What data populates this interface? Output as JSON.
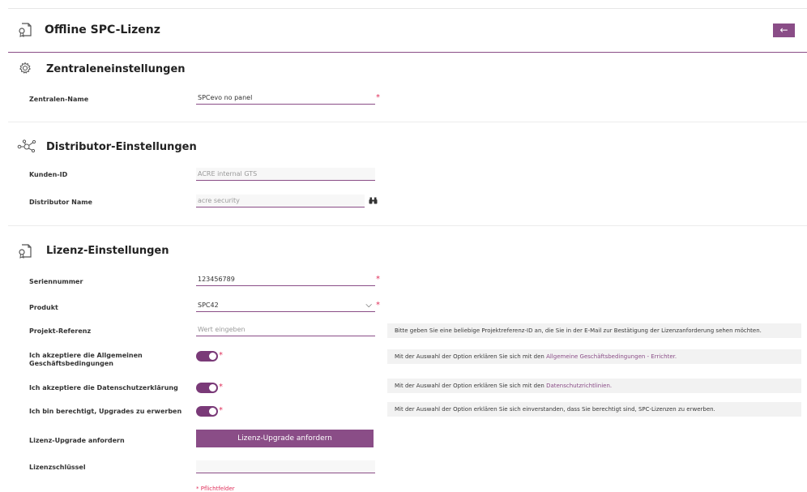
{
  "page": {
    "title": "Offline SPC-Lizenz",
    "back_icon": "←",
    "accent": "#8a4d87"
  },
  "zentrale": {
    "title": "Zentraleneinstellungen",
    "name_label": "Zentralen-Name",
    "name_value": "SPCevo no panel"
  },
  "distributor": {
    "title": "Distributor-Einstellungen",
    "kunden_label": "Kunden-ID",
    "kunden_value": "ACRE internal GTS",
    "name_label": "Distributor Name",
    "name_value": "acre security"
  },
  "lizenz": {
    "title": "Lizenz-Einstellungen",
    "serial_label": "Seriennummer",
    "serial_value": "123456789",
    "product_label": "Produkt",
    "product_value": "SPC42",
    "ref_label": "Projekt-Referenz",
    "ref_placeholder": "Wert eingeben",
    "ref_note": "Bitte geben Sie eine beliebige Projektreferenz-ID an, die Sie in der E-Mail zur Bestätigung der Lizenzanforderung sehen möchten.",
    "agb_label": "Ich akzeptiere die Allgemeinen Geschäftsbedingungen",
    "agb_note_prefix": "Mit der Auswahl der Option erklären Sie sich mit den ",
    "agb_note_link": "Allgemeine Geschäftsbedingungen - Errichter.",
    "ds_label": "Ich akzeptiere die Datenschutzerklärung",
    "ds_note_prefix": "Mit der Auswahl der Option erklären Sie sich mit den ",
    "ds_note_link": "Datenschutzrichtlinien.",
    "upgrade_label": "Ich bin berechtigt, Upgrades zu erwerben",
    "upgrade_note": "Mit der Auswahl der Option erklären Sie sich einverstanden, dass Sie berechtigt sind, SPC-Lizenzen zu erwerben.",
    "request_label": "Lizenz-Upgrade anfordern",
    "request_button": "Lizenz-Upgrade anfordern",
    "key_label": "Lizenzschlüssel",
    "key_value": "",
    "required_note": "* Pflichtfelder"
  },
  "required_mark": "*"
}
